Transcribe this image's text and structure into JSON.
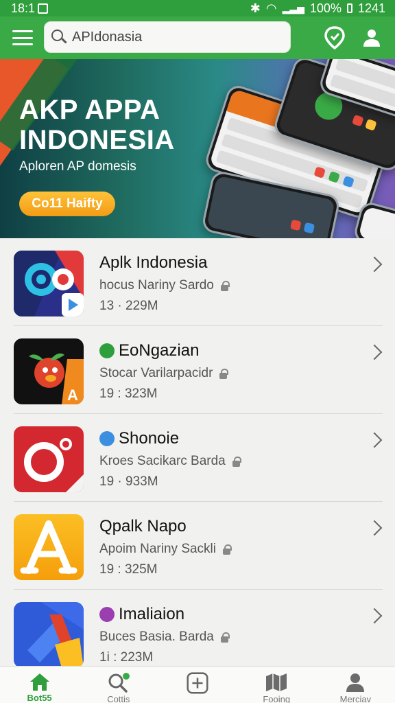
{
  "status_bar": {
    "time": "18:1",
    "battery": "100%",
    "clock": "1241"
  },
  "search": {
    "value": "APIdonasia"
  },
  "banner": {
    "title": "AKP APPA\nINDONESIA",
    "subtitle": "Aploren AP domesis",
    "cta_label": "Co11 Haifty"
  },
  "apps": [
    {
      "name": "Aplk Indonesia",
      "developer": "hocus Nariny Sardo",
      "size": "13 · 229M",
      "icon": "map-pin-icon"
    },
    {
      "name": "EoNgazian",
      "developer": "Stocar Varilarpacidr",
      "size": "19 : 323M",
      "icon": "tomato-mascot-icon",
      "badge_color": "#2f9e3c"
    },
    {
      "name": "Shonoie",
      "developer": "Kroes Sacikarc Barda",
      "size": "19 · 933M",
      "icon": "camera-icon",
      "badge_color": "#3b8fe0"
    },
    {
      "name": "Qpalk Napo",
      "developer": "Apoim Nariny Sackli",
      "size": "19 : 325M",
      "icon": "letter-a-icon"
    },
    {
      "name": "Imaliaion",
      "developer": "Buces Basia. Barda",
      "size": "1i : 223M",
      "icon": "shapes-icon",
      "badge_color": "#9b3fb0"
    }
  ],
  "bottom_nav": [
    {
      "label": "Bot55",
      "icon": "home-icon",
      "active": true
    },
    {
      "label": "Cottis",
      "icon": "search-icon"
    },
    {
      "label": "",
      "icon": "add-box-icon"
    },
    {
      "label": "Fooing",
      "icon": "map-icon"
    },
    {
      "label": "Merciav",
      "icon": "person-icon"
    }
  ],
  "colors": {
    "primary": "#3aaa46",
    "status_bar": "#2f9e3c",
    "cta": "#f29b14"
  }
}
